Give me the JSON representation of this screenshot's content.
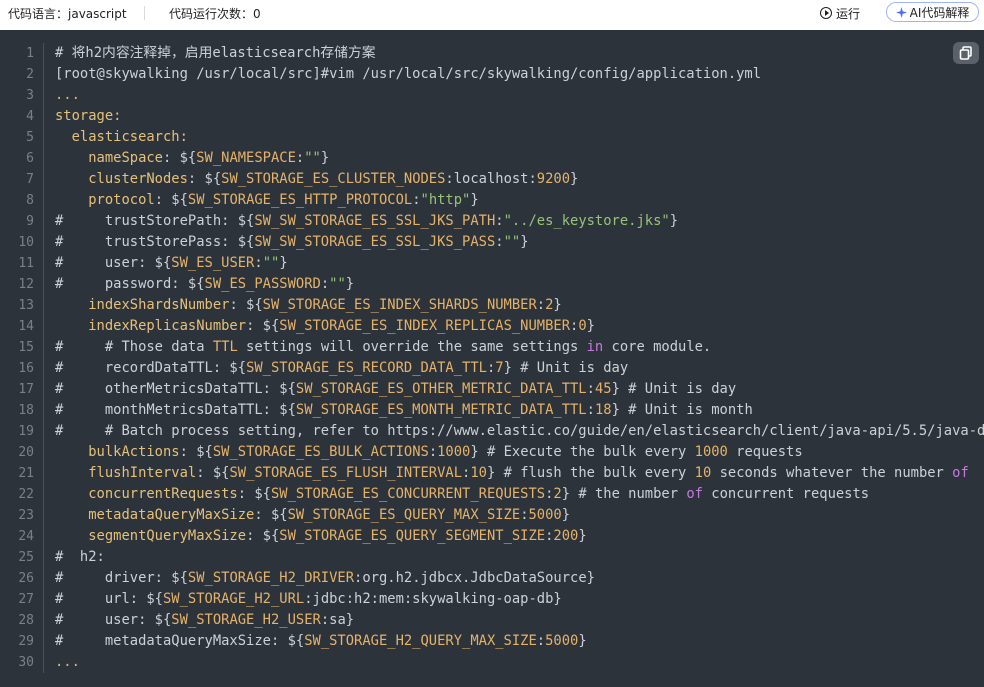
{
  "toolbar": {
    "language_label": "代码语言：javascript",
    "run_count_label": "代码运行次数：0",
    "run_label": "运行",
    "ai_label": "AI代码解释"
  },
  "code": {
    "lines": [
      {
        "num": "1",
        "segs": [
          [
            "c",
            "# 将h2内容注释掉，启用elasticsearch存储方案"
          ]
        ]
      },
      {
        "num": "2",
        "segs": [
          [
            "txt",
            "[root@skywalking /usr/local/src]#vim /usr/local/src/skywalking/config/application.yml"
          ]
        ]
      },
      {
        "num": "3",
        "segs": [
          [
            "v",
            "..."
          ]
        ]
      },
      {
        "num": "4",
        "segs": [
          [
            "k",
            "storage:"
          ]
        ]
      },
      {
        "num": "5",
        "segs": [
          [
            "k",
            "  elasticsearch:"
          ]
        ]
      },
      {
        "num": "6",
        "segs": [
          [
            "k",
            "    nameSpace"
          ],
          [
            "p",
            ": ${"
          ],
          [
            "v",
            "SW_NAMESPACE"
          ],
          [
            "p",
            ":"
          ],
          [
            "s",
            "\"\""
          ],
          [
            "p",
            "}"
          ]
        ]
      },
      {
        "num": "7",
        "segs": [
          [
            "k",
            "    clusterNodes"
          ],
          [
            "p",
            ": ${"
          ],
          [
            "v",
            "SW_STORAGE_ES_CLUSTER_NODES"
          ],
          [
            "p",
            ":localhost:"
          ],
          [
            "n",
            "9200"
          ],
          [
            "p",
            "}"
          ]
        ]
      },
      {
        "num": "8",
        "segs": [
          [
            "k",
            "    protocol"
          ],
          [
            "p",
            ": ${"
          ],
          [
            "v",
            "SW_STORAGE_ES_HTTP_PROTOCOL"
          ],
          [
            "p",
            ":"
          ],
          [
            "s",
            "\"http\""
          ],
          [
            "p",
            "}"
          ]
        ]
      },
      {
        "num": "9",
        "segs": [
          [
            "c",
            "#     trustStorePath: ${"
          ],
          [
            "v",
            "SW_SW_STORAGE_ES_SSL_JKS_PATH"
          ],
          [
            "p",
            ":"
          ],
          [
            "s",
            "\"../es_keystore.jks\""
          ],
          [
            "p",
            "}"
          ]
        ]
      },
      {
        "num": "10",
        "segs": [
          [
            "c",
            "#     trustStorePass: ${"
          ],
          [
            "v",
            "SW_SW_STORAGE_ES_SSL_JKS_PASS"
          ],
          [
            "p",
            ":"
          ],
          [
            "s",
            "\"\""
          ],
          [
            "p",
            "}"
          ]
        ]
      },
      {
        "num": "11",
        "segs": [
          [
            "c",
            "#     user: ${"
          ],
          [
            "v",
            "SW_ES_USER"
          ],
          [
            "p",
            ":"
          ],
          [
            "s",
            "\"\""
          ],
          [
            "p",
            "}"
          ]
        ]
      },
      {
        "num": "12",
        "segs": [
          [
            "c",
            "#     password: ${"
          ],
          [
            "v",
            "SW_ES_PASSWORD"
          ],
          [
            "p",
            ":"
          ],
          [
            "s",
            "\"\""
          ],
          [
            "p",
            "}"
          ]
        ]
      },
      {
        "num": "13",
        "segs": [
          [
            "k",
            "    indexShardsNumber"
          ],
          [
            "p",
            ": ${"
          ],
          [
            "v",
            "SW_STORAGE_ES_INDEX_SHARDS_NUMBER"
          ],
          [
            "p",
            ":"
          ],
          [
            "n",
            "2"
          ],
          [
            "p",
            "}"
          ]
        ]
      },
      {
        "num": "14",
        "segs": [
          [
            "k",
            "    indexReplicasNumber"
          ],
          [
            "p",
            ": ${"
          ],
          [
            "v",
            "SW_STORAGE_ES_INDEX_REPLICAS_NUMBER"
          ],
          [
            "p",
            ":"
          ],
          [
            "n",
            "0"
          ],
          [
            "p",
            "}"
          ]
        ]
      },
      {
        "num": "15",
        "segs": [
          [
            "c",
            "#     # Those data "
          ],
          [
            "v",
            "TTL"
          ],
          [
            "c",
            " settings will override the same settings "
          ],
          [
            "kw",
            "in"
          ],
          [
            "c",
            " core module."
          ]
        ]
      },
      {
        "num": "16",
        "segs": [
          [
            "c",
            "#     recordDataTTL: ${"
          ],
          [
            "v",
            "SW_STORAGE_ES_RECORD_DATA_TTL"
          ],
          [
            "p",
            ":"
          ],
          [
            "n",
            "7"
          ],
          [
            "p",
            "} # Unit is day"
          ]
        ]
      },
      {
        "num": "17",
        "segs": [
          [
            "c",
            "#     otherMetricsDataTTL: ${"
          ],
          [
            "v",
            "SW_STORAGE_ES_OTHER_METRIC_DATA_TTL"
          ],
          [
            "p",
            ":"
          ],
          [
            "n",
            "45"
          ],
          [
            "p",
            "} # Unit is day"
          ]
        ]
      },
      {
        "num": "18",
        "segs": [
          [
            "c",
            "#     monthMetricsDataTTL: ${"
          ],
          [
            "v",
            "SW_STORAGE_ES_MONTH_METRIC_DATA_TTL"
          ],
          [
            "p",
            ":"
          ],
          [
            "n",
            "18"
          ],
          [
            "p",
            "} # Unit is month"
          ]
        ]
      },
      {
        "num": "19",
        "segs": [
          [
            "c",
            "#     # Batch process setting, refer to https://www.elastic.co/guide/en/elasticsearch/client/java-api/5.5/java-d"
          ]
        ]
      },
      {
        "num": "20",
        "segs": [
          [
            "k",
            "    bulkActions"
          ],
          [
            "p",
            ": ${"
          ],
          [
            "v",
            "SW_STORAGE_ES_BULK_ACTIONS"
          ],
          [
            "p",
            ":"
          ],
          [
            "n",
            "1000"
          ],
          [
            "p",
            "} # Execute the bulk every "
          ],
          [
            "n",
            "1000"
          ],
          [
            "p",
            " requests"
          ]
        ]
      },
      {
        "num": "21",
        "segs": [
          [
            "k",
            "    flushInterval"
          ],
          [
            "p",
            ": ${"
          ],
          [
            "v",
            "SW_STORAGE_ES_FLUSH_INTERVAL"
          ],
          [
            "p",
            ":"
          ],
          [
            "n",
            "10"
          ],
          [
            "p",
            "} # flush the bulk every "
          ],
          [
            "n",
            "10"
          ],
          [
            "p",
            " seconds whatever the number "
          ],
          [
            "kw",
            "of"
          ]
        ]
      },
      {
        "num": "22",
        "segs": [
          [
            "k",
            "    concurrentRequests"
          ],
          [
            "p",
            ": ${"
          ],
          [
            "v",
            "SW_STORAGE_ES_CONCURRENT_REQUESTS"
          ],
          [
            "p",
            ":"
          ],
          [
            "n",
            "2"
          ],
          [
            "p",
            "} # the number "
          ],
          [
            "kw",
            "of"
          ],
          [
            "p",
            " concurrent requests"
          ]
        ]
      },
      {
        "num": "23",
        "segs": [
          [
            "k",
            "    metadataQueryMaxSize"
          ],
          [
            "p",
            ": ${"
          ],
          [
            "v",
            "SW_STORAGE_ES_QUERY_MAX_SIZE"
          ],
          [
            "p",
            ":"
          ],
          [
            "n",
            "5000"
          ],
          [
            "p",
            "}"
          ]
        ]
      },
      {
        "num": "24",
        "segs": [
          [
            "k",
            "    segmentQueryMaxSize"
          ],
          [
            "p",
            ": ${"
          ],
          [
            "v",
            "SW_STORAGE_ES_QUERY_SEGMENT_SIZE"
          ],
          [
            "p",
            ":"
          ],
          [
            "n",
            "200"
          ],
          [
            "p",
            "}"
          ]
        ]
      },
      {
        "num": "25",
        "segs": [
          [
            "c",
            "#  h2:"
          ]
        ]
      },
      {
        "num": "26",
        "segs": [
          [
            "c",
            "#     driver: ${"
          ],
          [
            "v",
            "SW_STORAGE_H2_DRIVER"
          ],
          [
            "p",
            ":org.h2.jdbcx.JdbcDataSource}"
          ]
        ]
      },
      {
        "num": "27",
        "segs": [
          [
            "c",
            "#     url: ${"
          ],
          [
            "v",
            "SW_STORAGE_H2_URL"
          ],
          [
            "p",
            ":jdbc:h2:mem:skywalking-oap-db}"
          ]
        ]
      },
      {
        "num": "28",
        "segs": [
          [
            "c",
            "#     user: ${"
          ],
          [
            "v",
            "SW_STORAGE_H2_USER"
          ],
          [
            "p",
            ":sa}"
          ]
        ]
      },
      {
        "num": "29",
        "segs": [
          [
            "c",
            "#     metadataQueryMaxSize: ${"
          ],
          [
            "v",
            "SW_STORAGE_H2_QUERY_MAX_SIZE"
          ],
          [
            "p",
            ":"
          ],
          [
            "n",
            "5000"
          ],
          [
            "p",
            "}"
          ]
        ]
      },
      {
        "num": "30",
        "segs": [
          [
            "v",
            "..."
          ]
        ]
      }
    ]
  },
  "colors": {
    "editor_bg": "#2c333a",
    "accent_border": "#9fb4ff"
  },
  "icons": {
    "run": "play-circle-icon",
    "ai": "sparkle-icon",
    "copy": "copy-icon"
  }
}
